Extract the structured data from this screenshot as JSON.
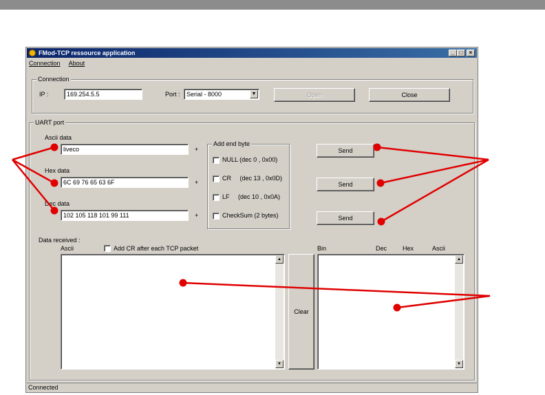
{
  "window": {
    "title": "FMod-TCP ressource application",
    "caption_buttons": [
      "_",
      "□",
      "×"
    ]
  },
  "menu": [
    "Connection",
    "About"
  ],
  "connection": {
    "group_label": "Connection",
    "ip_label": "IP :",
    "ip_value": "169.254.5.5",
    "port_label": "Port :",
    "port_value": "Serial - 8000",
    "open_label": "Open",
    "close_label": "Close"
  },
  "uart": {
    "group_label": "UART port",
    "ascii_label": "Ascii data",
    "ascii_value": "liveco",
    "hex_label": "Hex data",
    "hex_value": "6C 69 76 65 63 6F",
    "dec_label": "Dec data",
    "dec_value": "102 105 118 101 99 111",
    "plus": "+",
    "end_byte": {
      "group_label": "Add end byte",
      "options": [
        "NULL (dec 0 , 0x00)",
        "CR     (dec 13 , 0x0D)",
        "LF     (dec 10 , 0x0A)",
        "CheckSum (2 bytes)"
      ]
    },
    "send_label": "Send",
    "received_label": "Data received :",
    "ascii_col": "Ascii",
    "add_cr_label": "Add CR after each TCP packet",
    "clear_label": "Clear",
    "bin_headers": [
      "Bin",
      "Dec",
      "Hex",
      "Ascii"
    ]
  },
  "status": "Connected",
  "annotation_color": "#e00000"
}
